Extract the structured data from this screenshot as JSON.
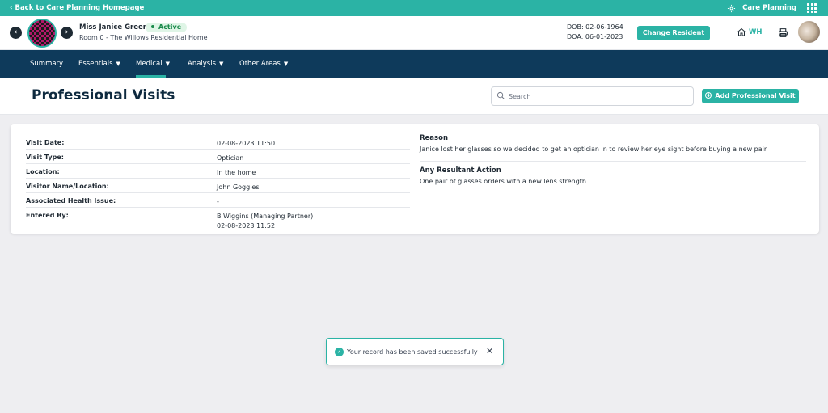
{
  "topbar": {
    "back_label": "Back to Care Planning Homepage",
    "app_label": "Care Planning",
    "icons": [
      "chevron-left-icon",
      "gear-icon",
      "apps-grid-icon"
    ]
  },
  "resident": {
    "name": "Miss Janice Green",
    "status": "Active",
    "room": "Room 0 - The Willows Residential Home",
    "dob": "DOB: 02-06-1964",
    "doa": "DOA: 06-01-2023",
    "change_label": "Change Resident",
    "home_code": "WH"
  },
  "nav": {
    "items": [
      {
        "label": "Summary",
        "has_dropdown": false
      },
      {
        "label": "Essentials",
        "has_dropdown": true
      },
      {
        "label": "Medical",
        "has_dropdown": true,
        "active": true
      },
      {
        "label": "Analysis",
        "has_dropdown": true
      },
      {
        "label": "Other Areas",
        "has_dropdown": true
      }
    ]
  },
  "page": {
    "title": "Professional Visits",
    "search_placeholder": "Search",
    "add_label": "Add Professional Visit"
  },
  "visit": {
    "fields": [
      {
        "label": "Visit Date:",
        "value": "02-08-2023 11:50"
      },
      {
        "label": "Visit Type:",
        "value": "Optician"
      },
      {
        "label": "Location:",
        "value": "In the home"
      },
      {
        "label": "Visitor Name/Location:",
        "value": "John Goggles"
      },
      {
        "label": "Associated Health Issue:",
        "value": "-"
      },
      {
        "label": "Entered By:",
        "value": "B Wiggins (Managing Partner)",
        "value2": "02-08-2023 11:52"
      }
    ],
    "reason_title": "Reason",
    "reason_text": "Janice lost her glasses so we decided to get an optician in to review her eye sight before buying a new pair",
    "action_title": "Any Resultant Action",
    "action_text": "One pair of glasses orders with a new lens strength."
  },
  "toast": {
    "message": "Your record has been saved successfully"
  },
  "colors": {
    "accent": "#2bb3a5",
    "nav_bg": "#0e3a5b",
    "page_bg": "#eeeef1",
    "active_badge_bg": "#dff5e6",
    "active_badge_text": "#1b8a4b"
  }
}
